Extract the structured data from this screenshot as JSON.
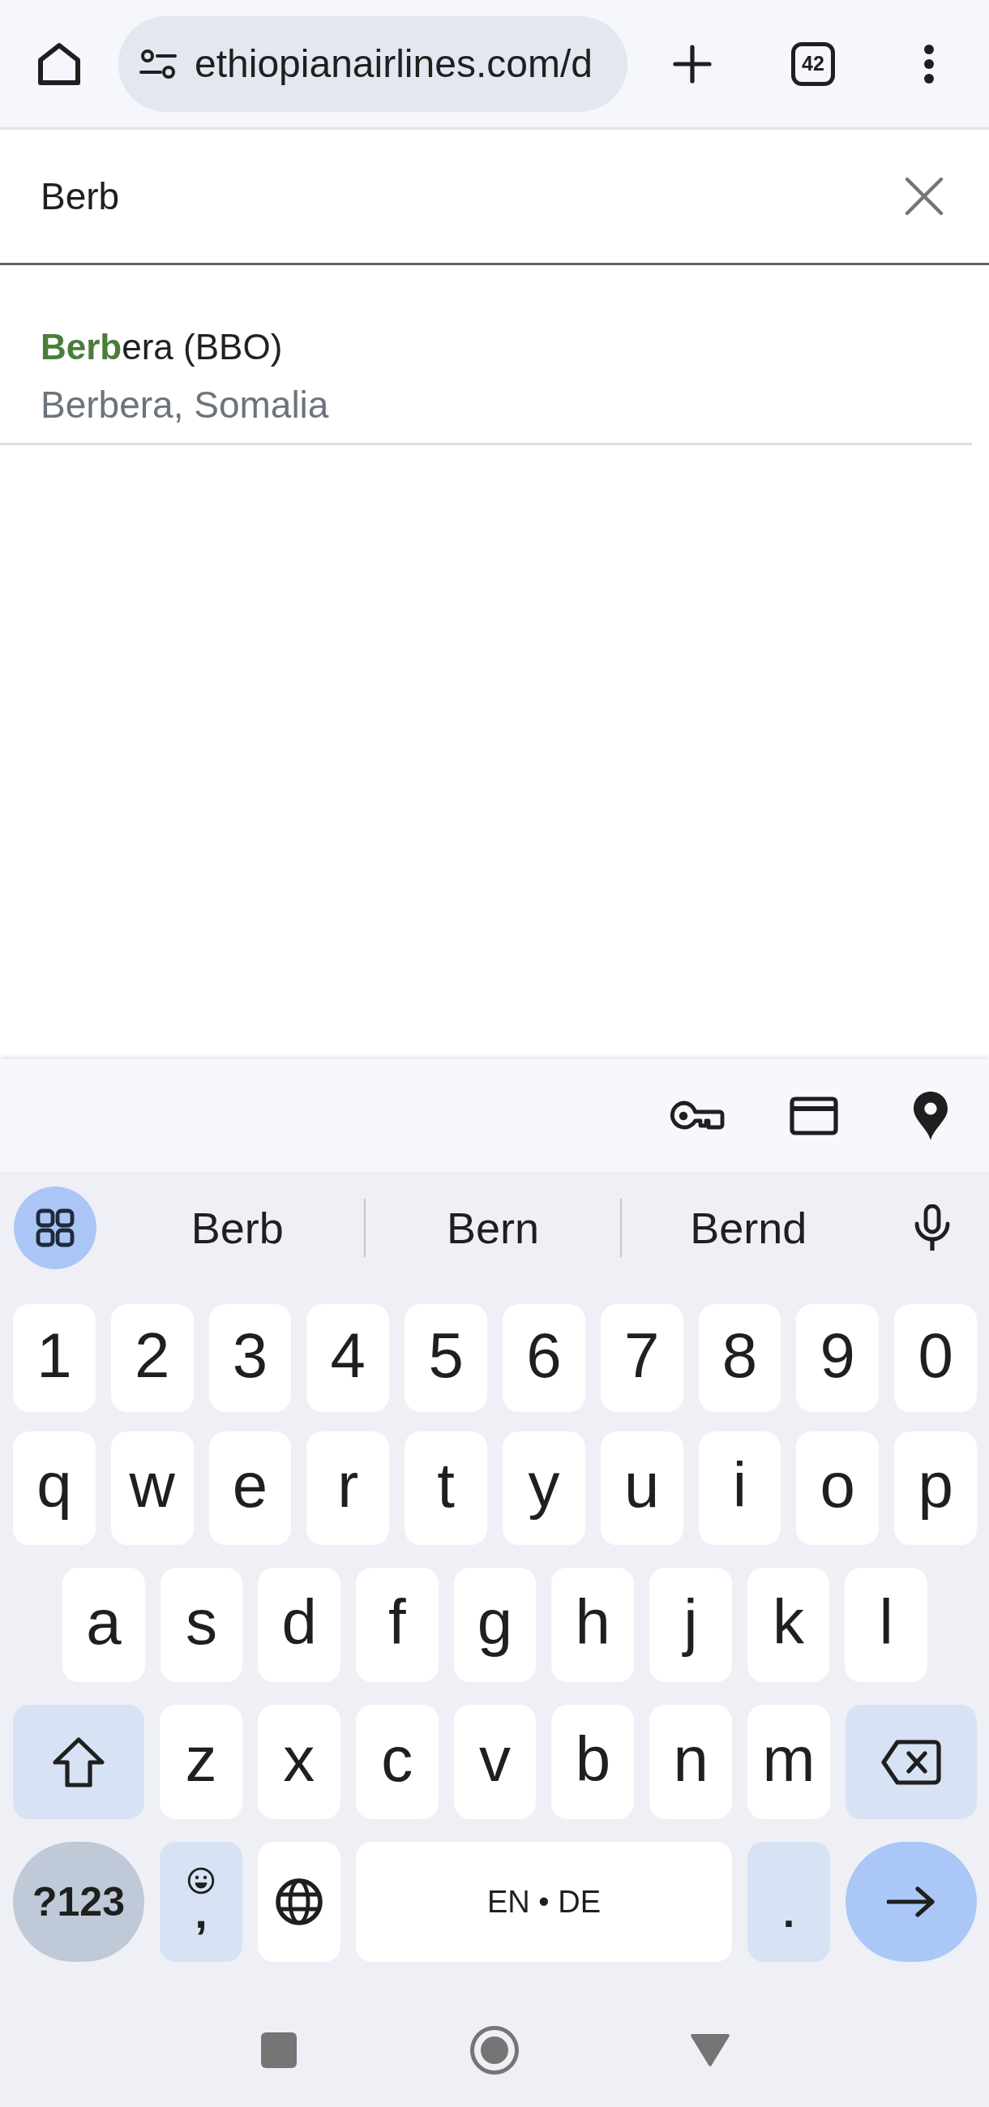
{
  "browser": {
    "url": "ethiopianairlines.com/d",
    "tab_count": "42"
  },
  "search": {
    "value": "Berb"
  },
  "results": [
    {
      "title": "**Berb**era (BBO)",
      "subtitle": "Berbera, Somalia"
    }
  ],
  "keyboard": {
    "suggestions": [
      "Berb",
      "Bern",
      "Bernd"
    ],
    "rows": [
      {
        "keys": [
          {
            "kind": "char",
            "label": "1"
          },
          {
            "kind": "char",
            "label": "2"
          },
          {
            "kind": "char",
            "label": "3"
          },
          {
            "kind": "char",
            "label": "4"
          },
          {
            "kind": "char",
            "label": "5"
          },
          {
            "kind": "char",
            "label": "6"
          },
          {
            "kind": "char",
            "label": "7"
          },
          {
            "kind": "char",
            "label": "8"
          },
          {
            "kind": "char",
            "label": "9"
          },
          {
            "kind": "char",
            "label": "0"
          }
        ]
      },
      {
        "keys": [
          {
            "kind": "char",
            "label": "q"
          },
          {
            "kind": "char",
            "label": "w"
          },
          {
            "kind": "char",
            "label": "e"
          },
          {
            "kind": "char",
            "label": "r"
          },
          {
            "kind": "char",
            "label": "t"
          },
          {
            "kind": "char",
            "label": "y"
          },
          {
            "kind": "char",
            "label": "u"
          },
          {
            "kind": "char",
            "label": "i"
          },
          {
            "kind": "char",
            "label": "o"
          },
          {
            "kind": "char",
            "label": "p"
          }
        ]
      },
      {
        "keys": [
          {
            "kind": "char",
            "label": "a"
          },
          {
            "kind": "char",
            "label": "s"
          },
          {
            "kind": "char",
            "label": "d"
          },
          {
            "kind": "char",
            "label": "f"
          },
          {
            "kind": "char",
            "label": "g"
          },
          {
            "kind": "char",
            "label": "h"
          },
          {
            "kind": "char",
            "label": "j"
          },
          {
            "kind": "char",
            "label": "k"
          },
          {
            "kind": "char",
            "label": "l"
          }
        ]
      },
      {
        "keys": [
          {
            "kind": "shift"
          },
          {
            "kind": "char",
            "label": "z"
          },
          {
            "kind": "char",
            "label": "x"
          },
          {
            "kind": "char",
            "label": "c"
          },
          {
            "kind": "char",
            "label": "v"
          },
          {
            "kind": "char",
            "label": "b"
          },
          {
            "kind": "char",
            "label": "n"
          },
          {
            "kind": "char",
            "label": "m"
          },
          {
            "kind": "backspace"
          }
        ]
      },
      {
        "keys": [
          {
            "kind": "symbols",
            "label": "?123"
          },
          {
            "kind": "comma",
            "label": ","
          },
          {
            "kind": "globe"
          },
          {
            "kind": "space",
            "label": "EN • DE"
          },
          {
            "kind": "period",
            "label": "."
          },
          {
            "kind": "enter"
          }
        ]
      }
    ]
  }
}
